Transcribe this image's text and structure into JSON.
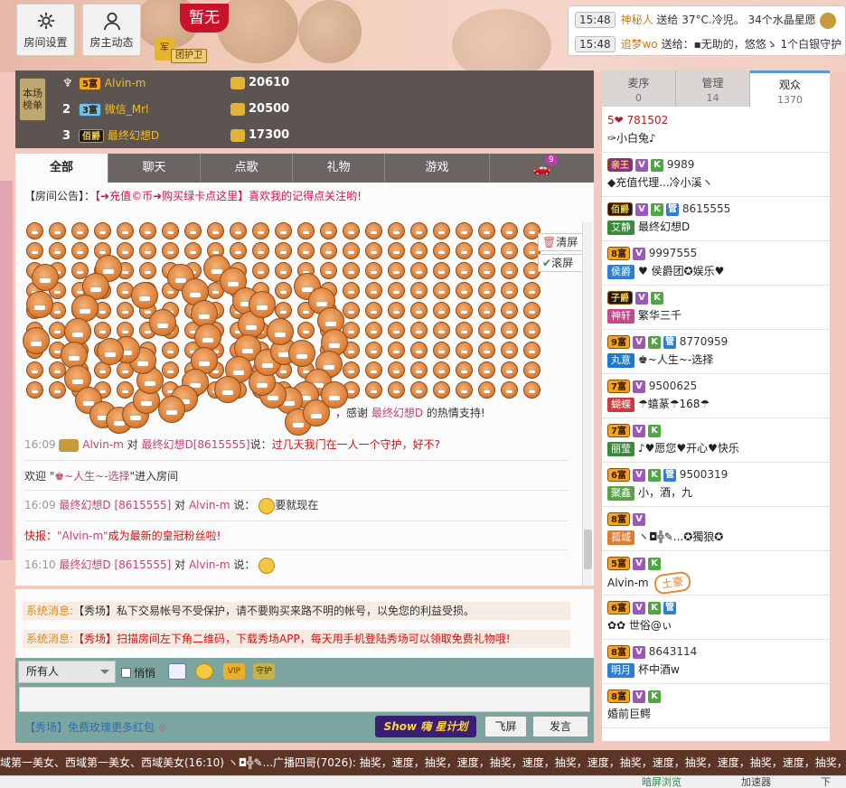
{
  "top": {
    "room_settings": "房间设置",
    "host_feed": "房主动态",
    "no_title": "暂无",
    "guard_badge": "军",
    "guard_label": "团护卫"
  },
  "gift_feed": [
    {
      "time": "15:48",
      "user": "神秘人",
      "action": " 送给 ",
      "text": "37°C.冷児。 34个水晶星愿"
    },
    {
      "time": "15:48",
      "user": "追梦wo",
      "action": " 送给：",
      "text": "▪无助的，悠悠ゝ 1个白银守护"
    }
  ],
  "ranking": {
    "side_label": "本场榜单",
    "rows": [
      {
        "no": "1",
        "badge": "5富",
        "name": "Alvin-m",
        "score": "20610"
      },
      {
        "no": "2",
        "badge": "3富",
        "name": "微信_Mrl",
        "score": "20500"
      },
      {
        "no": "3",
        "badge": "佰爵",
        "name": "最终幻想D",
        "score": "17300"
      }
    ]
  },
  "tabs": [
    "全部",
    "聊天",
    "点歌",
    "礼物",
    "游戏"
  ],
  "car_count": "9",
  "notice": {
    "label": "【房间公告】：",
    "link": "【➜充值©币➜购买绿卡点这里】",
    "text": "喜欢我的记得点关注哟!"
  },
  "chat_tools": {
    "clear": "清屏",
    "scroll": "滚屏"
  },
  "emoticon_label": "加油!",
  "thanks": {
    "prefix": "，感谢 ",
    "user": "最终幻想D",
    "suffix": " 的热情支持!"
  },
  "messages": {
    "m1": {
      "time": "16:09",
      "from": "Alvin-m",
      "mid": " 对 ",
      "to": "最终幻想D[8615555]",
      "say": "说：",
      "text": "过几天我门在一人一个守护，好不?"
    },
    "m2": {
      "pre": "欢迎 \"",
      "name": "♚~人生~-选择",
      "post": "\"进入房间"
    },
    "m3": {
      "time": "16:09",
      "from": "最终幻想D [8615555]",
      "mid": " 对 ",
      "to": "Alvin-m",
      "say": " 说：",
      "text": "要就现在"
    },
    "m4": {
      "pre": "快报：",
      "name": "\"Alvin-m\"",
      "post": "成为最新的皇冠粉丝啦!"
    },
    "m5": {
      "time": "16:10",
      "from": "最终幻想D [8615555]",
      "mid": " 对 ",
      "to": "Alvin-m",
      "say": " 说："
    }
  },
  "system": [
    {
      "label": "系统消息:",
      "text": "【秀场】私下交易帐号不受保护，请不要购买来路不明的帐号，以免您的利益受损。"
    },
    {
      "label": "系统消息:",
      "text": "【秀场】扫描房间左下角二维码，下载秀场APP，每天用手机登陆秀场可以领取免费礼物哦!"
    }
  ],
  "input": {
    "target": "所有人",
    "whisper": "悄悄",
    "vip": "VIP",
    "guard": "守护",
    "promo": "【秀场】免费玫瑰更多红包",
    "show_logo": "Show 嗨 星计划",
    "fly": "飞屏",
    "send": "发言"
  },
  "right_tabs": [
    {
      "label": "麦序",
      "count": "0"
    },
    {
      "label": "管理",
      "count": "14"
    },
    {
      "label": "观众",
      "count": "1370"
    }
  ],
  "users": [
    {
      "l1": "5❤ 781502",
      "l2": "✑小白兔♪"
    },
    {
      "b": "亲王",
      "l1": "9989",
      "l2": "◆充值代理...冷小溪ヽ"
    },
    {
      "b": "佰爵",
      "l1": "8615555",
      "tag": "艾静",
      "l2": "最终幻想D"
    },
    {
      "b": "8富",
      "l1": "9997555",
      "tag": "侯爵",
      "l2": "♥ 侯爵团✪娱乐♥"
    },
    {
      "b": "子爵",
      "l1": "",
      "tag": "神轩",
      "l2": "繁华三千"
    },
    {
      "b": "9富",
      "l1": "8770959",
      "tag": "丸意",
      "l2": "♚~人生~-选择"
    },
    {
      "b": "7富",
      "l1": "9500625",
      "tag": "蝴蝶",
      "l2": "☂蟢蒃☂168☂"
    },
    {
      "b": "7富",
      "l1": "",
      "tag": "丽莹",
      "l2": "♪♥愿您♥开心♥快乐"
    },
    {
      "b": "6富",
      "l1": "9500319",
      "tag": "聚鑫",
      "l2": "小，酒，九"
    },
    {
      "b": "8富",
      "l1": "",
      "tag": "孤城",
      "l2": "ヽ◘╬✎...✪獨狼✪"
    },
    {
      "b": "5富",
      "l1": "",
      "l2": "Alvin-m",
      "stamp": "土豪"
    },
    {
      "b": "6富",
      "l1": "",
      "l2": "✿✿ 世俗@ぃ"
    },
    {
      "b": "8富",
      "l1": "8643114",
      "tag": "明月",
      "l2": "杯中酒w"
    },
    {
      "b": "8富",
      "l1": "",
      "l2": "婚前巨鳄"
    }
  ],
  "ticker": "域第一美女、西域第一美女、西域美女(16:10)    ヽ◘╬✎...广播四哥(7026): 抽奖，速度，抽奖，速度，抽奖，速度，抽奖，速度，抽奖，速度，抽奖，速度，抽奖，速度，抽奖，速度，抽奖，速度",
  "status": {
    "zoom": "",
    "items": [
      "暗屏浏览",
      "加速器",
      "下"
    ]
  }
}
